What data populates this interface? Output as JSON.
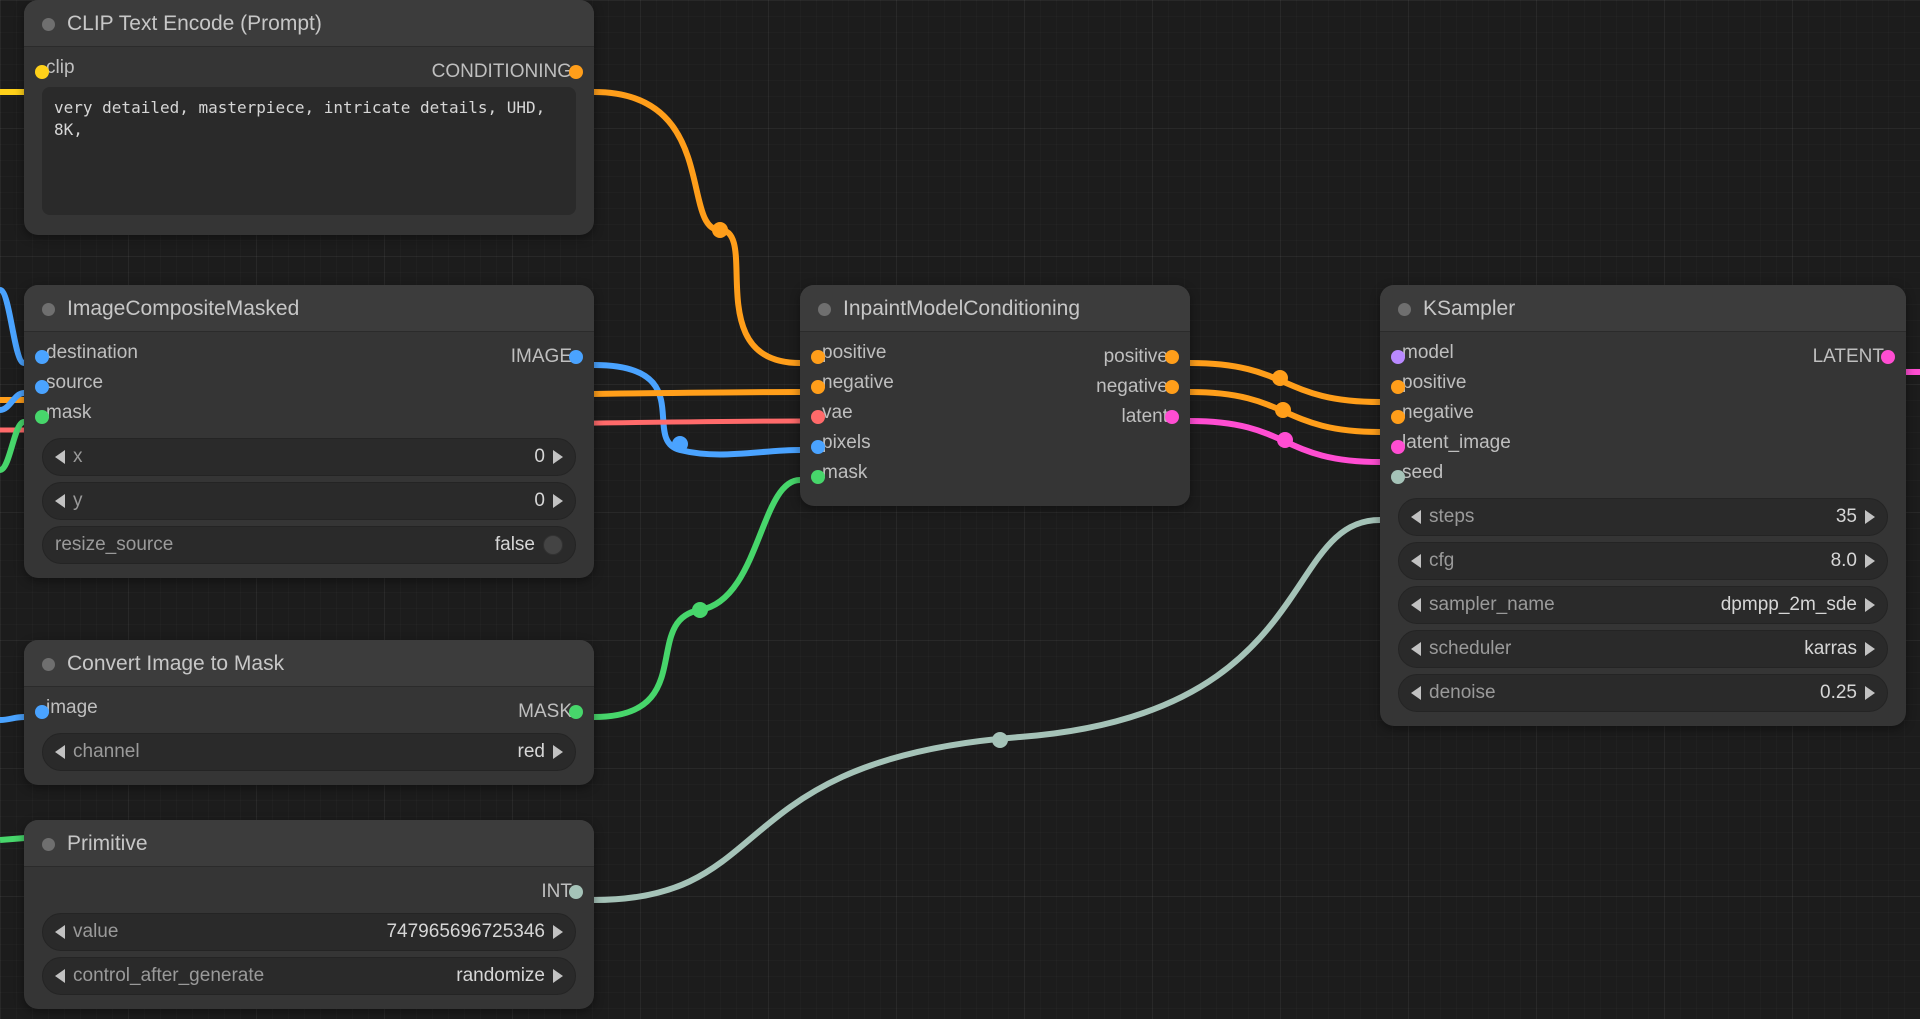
{
  "nodes": {
    "clip": {
      "title": "CLIP Text Encode (Prompt)",
      "inputs": {
        "clip": "clip"
      },
      "outputs": {
        "conditioning": "CONDITIONING"
      },
      "prompt": "very detailed, masterpiece, intricate details, UHD, 8K,"
    },
    "composite": {
      "title": "ImageCompositeMasked",
      "inputs": {
        "destination": "destination",
        "source": "source",
        "mask": "mask"
      },
      "outputs": {
        "image": "IMAGE"
      },
      "widgets": {
        "x_name": "x",
        "x_val": "0",
        "y_name": "y",
        "y_val": "0",
        "resize_name": "resize_source",
        "resize_val": "false"
      }
    },
    "convert": {
      "title": "Convert Image to Mask",
      "inputs": {
        "image": "image"
      },
      "outputs": {
        "mask": "MASK"
      },
      "widgets": {
        "channel_name": "channel",
        "channel_val": "red"
      }
    },
    "primitive": {
      "title": "Primitive",
      "outputs": {
        "int": "INT"
      },
      "widgets": {
        "value_name": "value",
        "value_val": "747965696725346",
        "ctrl_name": "control_after_generate",
        "ctrl_val": "randomize"
      }
    },
    "inpaint": {
      "title": "InpaintModelConditioning",
      "inputs": {
        "positive": "positive",
        "negative": "negative",
        "vae": "vae",
        "pixels": "pixels",
        "mask": "mask"
      },
      "outputs": {
        "positive": "positive",
        "negative": "negative",
        "latent": "latent"
      }
    },
    "ksampler": {
      "title": "KSampler",
      "inputs": {
        "model": "model",
        "positive": "positive",
        "negative": "negative",
        "latent_image": "latent_image",
        "seed": "seed"
      },
      "outputs": {
        "latent": "LATENT"
      },
      "widgets": {
        "steps_name": "steps",
        "steps_val": "35",
        "cfg_name": "cfg",
        "cfg_val": "8.0",
        "sampler_name_name": "sampler_name",
        "sampler_name_val": "dpmpp_2m_sde",
        "scheduler_name": "scheduler",
        "scheduler_val": "karras",
        "denoise_name": "denoise",
        "denoise_val": "0.25"
      }
    }
  }
}
